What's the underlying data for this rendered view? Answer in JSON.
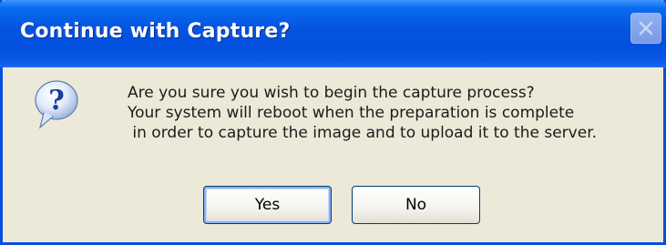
{
  "dialog": {
    "title": "Continue with Capture?",
    "message_lines": [
      "Are you sure you wish to begin the capture process?",
      "Your system will reboot when the preparation is complete",
      " in order to capture the image and to upload it to the server."
    ],
    "icon": "question-icon",
    "buttons": {
      "yes_label": "Yes",
      "no_label": "No"
    },
    "close_icon": "close-icon"
  },
  "colors": {
    "titlebar": "#0455e1",
    "frame": "#0a4ee0",
    "body": "#ece9d8"
  }
}
